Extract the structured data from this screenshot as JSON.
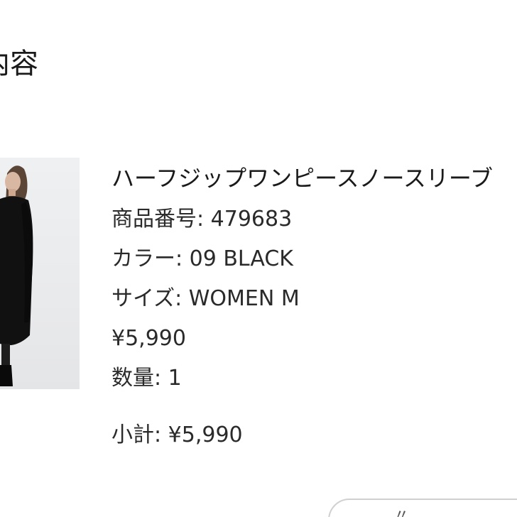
{
  "section": {
    "heading": "内容"
  },
  "product": {
    "image_alt": "ハーフジップワンピースノースリーブ product photo",
    "name": "ハーフジップワンピースノースリーブ",
    "number_label": "商品番号: 479683",
    "color_label": "カラー: 09 BLACK",
    "size_label": "サイズ: WOMEN M",
    "price": "¥5,990",
    "quantity_label": "数量: 1",
    "subtotal_label": "小計: ¥5,990"
  },
  "footer": {
    "button_label": "〃"
  }
}
